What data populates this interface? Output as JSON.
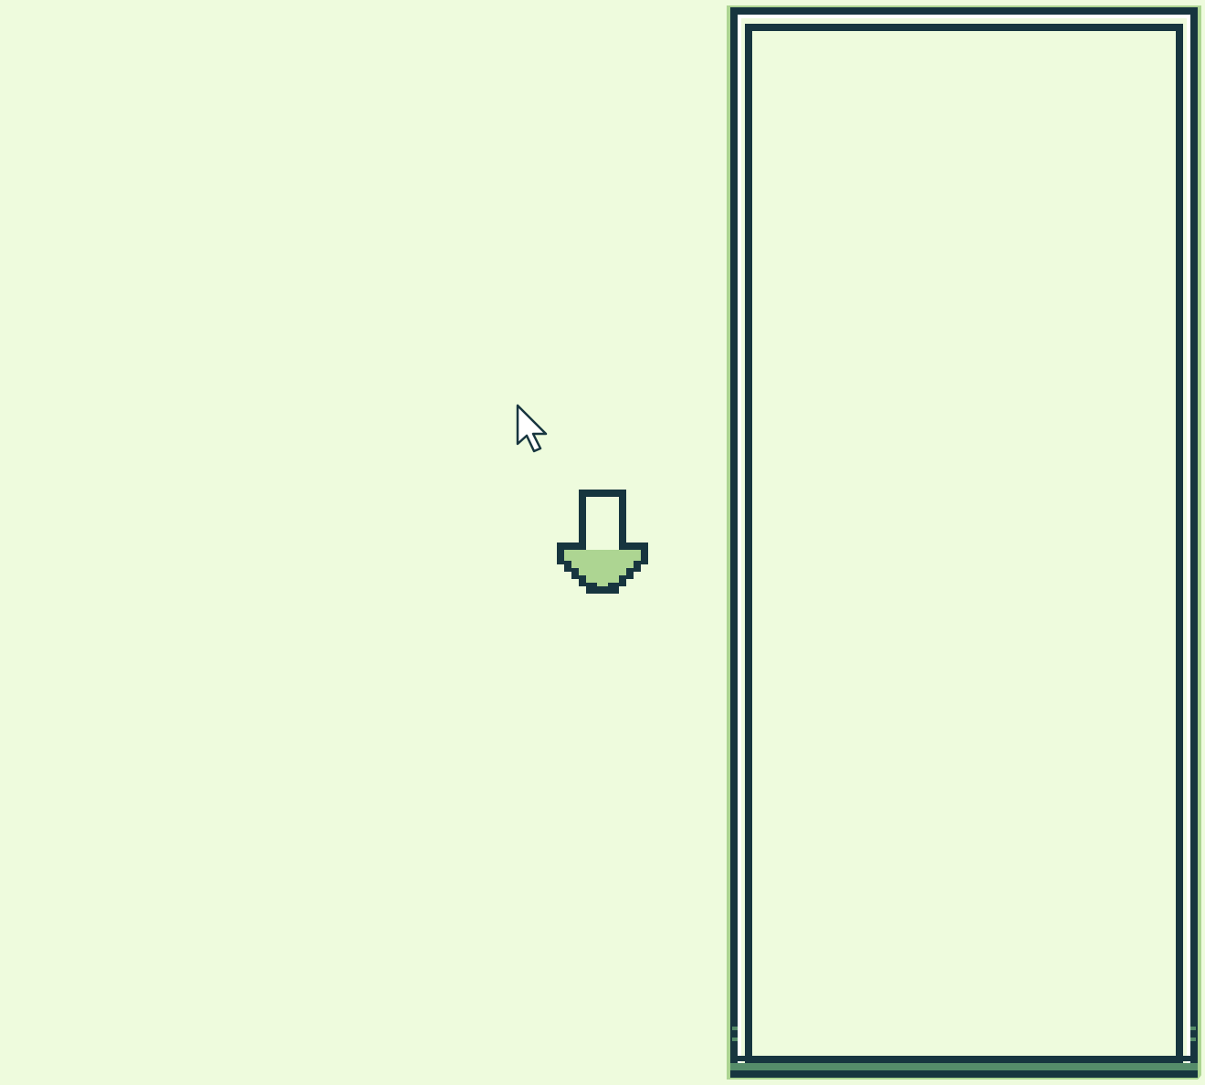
{
  "screen": {
    "colors": {
      "background": "#eefbdd",
      "dark": "#17353f",
      "light_green": "#add592",
      "mid_green": "#558c6a",
      "white": "#ffffff"
    }
  },
  "side_panel": {
    "name": "empty-dialog-panel",
    "text": ""
  },
  "cursor": {
    "icon": "mouse-pointer-icon"
  },
  "down_arrow": {
    "icon": "down-arrow-icon"
  }
}
